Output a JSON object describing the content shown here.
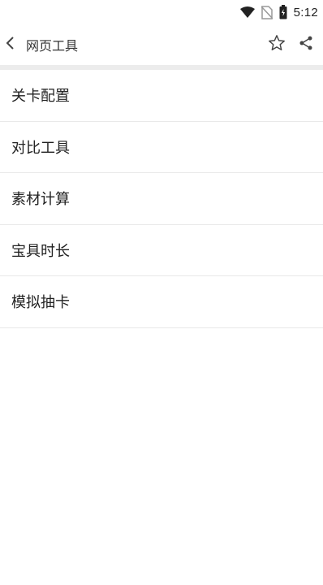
{
  "status_bar": {
    "time": "5:12",
    "icons": [
      "wifi-icon",
      "no-sim-icon",
      "battery-icon"
    ]
  },
  "app_bar": {
    "title": "网页工具",
    "icons": [
      "back-arrow-icon",
      "star-icon",
      "share-icon"
    ]
  },
  "menu": {
    "items": [
      {
        "label": "关卡配置"
      },
      {
        "label": "对比工具"
      },
      {
        "label": "素材计算"
      },
      {
        "label": "宝具时长"
      },
      {
        "label": "模拟抽卡"
      }
    ]
  }
}
